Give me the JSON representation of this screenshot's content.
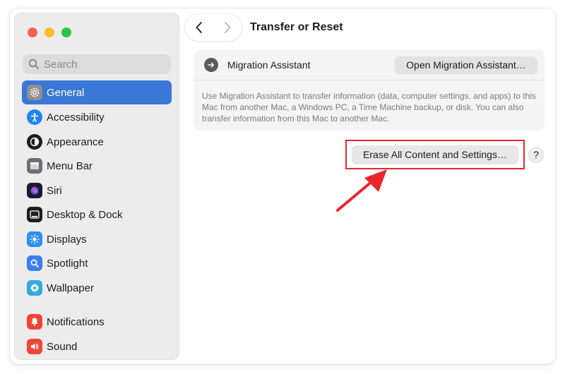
{
  "window": {
    "title": "Transfer or Reset"
  },
  "search": {
    "placeholder": "Search"
  },
  "sidebar": {
    "items": [
      {
        "label": "General",
        "icon": "gear-icon",
        "active": true
      },
      {
        "label": "Accessibility",
        "icon": "accessibility-icon"
      },
      {
        "label": "Appearance",
        "icon": "appearance-icon"
      },
      {
        "label": "Menu Bar",
        "icon": "menu-bar-icon"
      },
      {
        "label": "Siri",
        "icon": "siri-icon"
      },
      {
        "label": "Desktop & Dock",
        "icon": "desktop-dock-icon"
      },
      {
        "label": "Displays",
        "icon": "displays-icon"
      },
      {
        "label": "Spotlight",
        "icon": "spotlight-icon"
      },
      {
        "label": "Wallpaper",
        "icon": "wallpaper-icon"
      },
      {
        "label": "Notifications",
        "icon": "notifications-icon"
      },
      {
        "label": "Sound",
        "icon": "sound-icon"
      }
    ]
  },
  "migration": {
    "label": "Migration Assistant",
    "button_label": "Open Migration Assistant…",
    "description": "Use Migration Assistant to transfer information (data, computer settings, and apps) to this Mac from another Mac, a Windows PC, a Time Machine backup, or disk. You can also transfer information from this Mac to another Mac."
  },
  "erase": {
    "button_label": "Erase All Content and Settings…"
  },
  "help": {
    "label": "?"
  },
  "colors": {
    "accent": "#3a77d6",
    "highlight": "#e8262c"
  }
}
